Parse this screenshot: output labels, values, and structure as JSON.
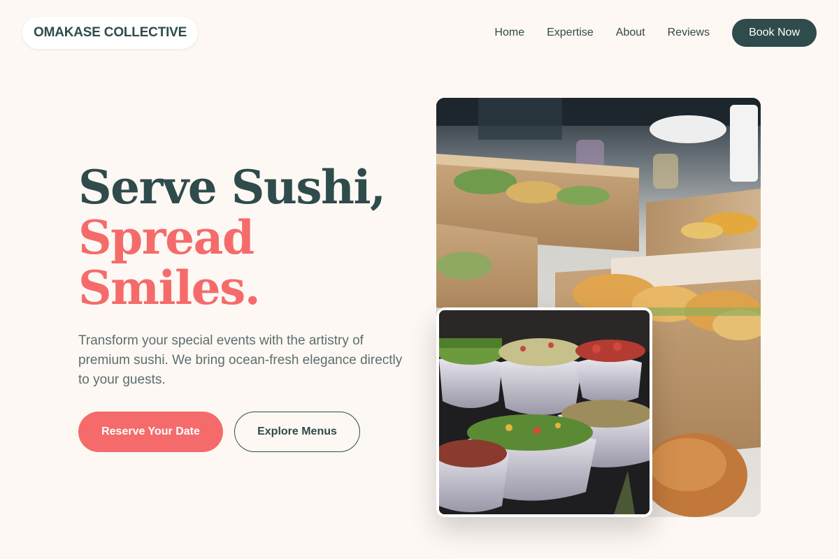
{
  "header": {
    "logo": "OMAKASE COLLECTIVE",
    "nav": [
      "Home",
      "Expertise",
      "About",
      "Reviews"
    ],
    "cta": "Book Now"
  },
  "hero": {
    "title_line1": "Serve Sushi,",
    "title_line2": "Spread",
    "title_line3": "Smiles.",
    "subtitle": "Transform your special events with the artistry of premium sushi. We bring ocean-fresh elegance directly to your guests.",
    "primary_button": "Reserve Your Date",
    "secondary_button": "Explore Menus"
  },
  "images": {
    "main_alt": "catering boxes with sandwiches",
    "overlay_alt": "bowls of fresh salads"
  },
  "colors": {
    "background": "#fdf8f3",
    "primary_dark": "#2f4b4b",
    "accent_coral": "#f56b6b",
    "text_muted": "#5c6e6e"
  }
}
